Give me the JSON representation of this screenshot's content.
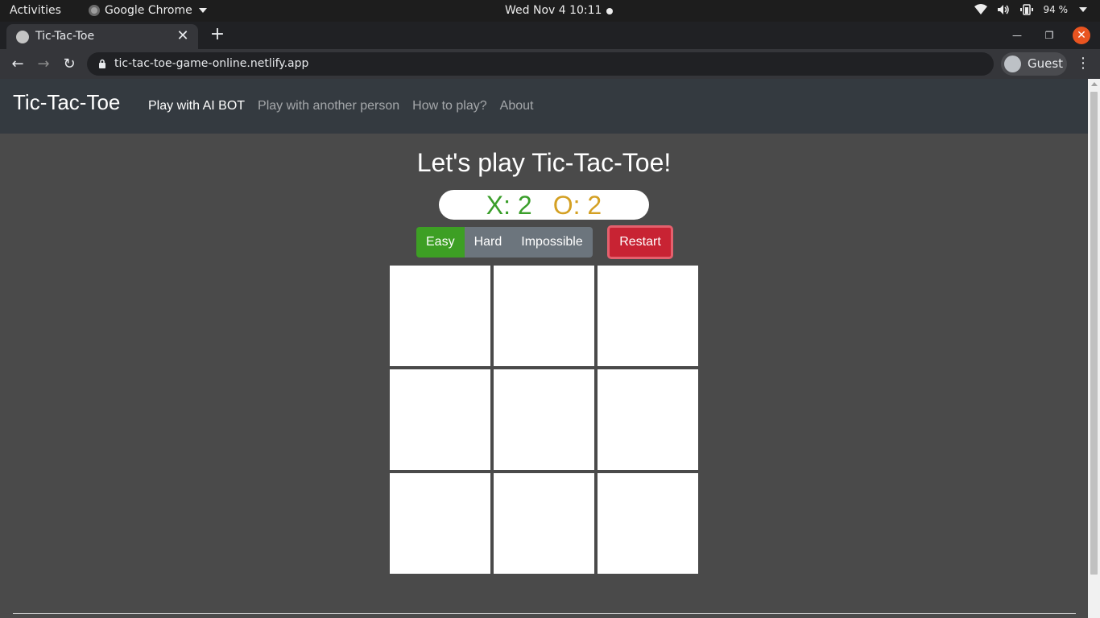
{
  "system": {
    "activities_label": "Activities",
    "app_name": "Google Chrome",
    "clock": "Wed Nov 4  10:11",
    "battery_percent": "94 %"
  },
  "browser": {
    "tab_title": "Tic-Tac-Toe",
    "tab_close": "✕",
    "new_tab": "+",
    "url": "tic-tac-toe-game-online.netlify.app",
    "profile_name": "Guest",
    "menu": "⋮"
  },
  "site": {
    "brand": "Tic-Tac-Toe",
    "nav": {
      "play_ai": "Play with AI BOT",
      "play_person": "Play with another person",
      "how_to": "How to play?",
      "about": "About"
    },
    "heading": "Let's play Tic-Tac-Toe!",
    "score": {
      "x": "X: 2",
      "o": "O: 2"
    },
    "difficulty": {
      "easy": "Easy",
      "hard": "Hard",
      "impossible": "Impossible",
      "selected": "Easy"
    },
    "restart": "Restart",
    "board": [
      "",
      "",
      "",
      "",
      "",
      "",
      "",
      "",
      ""
    ]
  },
  "colors": {
    "page_bg": "#4a4a4a",
    "navbar_bg": "#343a40",
    "x_color": "#3a9e2a",
    "o_color": "#d4a023",
    "easy_selected": "#3d9f24",
    "difficulty_bg": "#6c757d",
    "restart_bg": "#c82333"
  }
}
